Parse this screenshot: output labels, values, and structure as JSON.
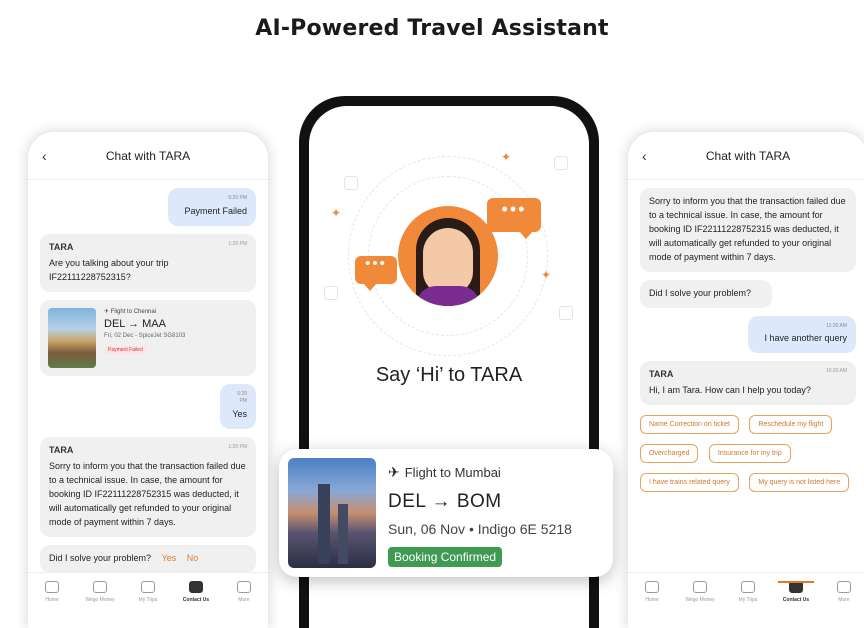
{
  "title": "AI-Powered Travel Assistant",
  "left_phone": {
    "header": {
      "back": "‹",
      "title": "Chat with TARA"
    },
    "messages": {
      "m1": {
        "time": "5:20 PM",
        "text": "Payment Failed"
      },
      "m2": {
        "name": "TARA",
        "time": "1:20 PM",
        "text": "Are you talking about your trip IF22111228752315?"
      },
      "trip": {
        "head": "Flight to Chennai",
        "route": "DEL → MAA",
        "date": "Fri, 02 Dec - SpiceJet SG8103",
        "status": "Payment Failed"
      },
      "m3": {
        "time": "5:20 PM",
        "text": "Yes"
      },
      "m4": {
        "name": "TARA",
        "time": "1:20 PM",
        "text": "Sorry to inform you that the transaction failed due to a technical issue. In case, the amount for booking ID IF22111228752315 was deducted, it will automatically get refunded to your original mode of payment within 7 days."
      },
      "m5": {
        "text": "Did I solve your problem?",
        "yes": "Yes",
        "no": "No"
      }
    }
  },
  "center_phone": {
    "say_hi": "Say ‘Hi’ to TARA",
    "bubble": "•••"
  },
  "flight_card": {
    "head": "Flight to Mumbai",
    "route": "DEL → BOM",
    "date": "Sun, 06 Nov • Indigo 6E 5218",
    "status": "Booking Confirmed"
  },
  "right_phone": {
    "header": {
      "back": "‹",
      "title": "Chat with TARA"
    },
    "messages": {
      "m1": {
        "text": "Sorry to inform you that the transaction failed due to a technical issue. In case, the amount for booking ID IF22111228752315 was deducted, it will automatically get refunded to your original mode of payment within 7 days."
      },
      "m2": {
        "text": "Did I solve your problem?"
      },
      "m3": {
        "time": "11:20 AM",
        "text": "I have another query"
      },
      "m4": {
        "name": "TARA",
        "time": "10:20 AM",
        "text": "Hi, I am Tara. How can I help you today?"
      }
    },
    "quick_replies": [
      "Name Correction on ticket",
      "Reschedule my flight",
      "Overcharged",
      "Insurance for my trip",
      "I have trains related query",
      "My query is not listed here"
    ]
  },
  "tabs": [
    "Home",
    "Wego Money",
    "My Trips",
    "Contact Us",
    "More"
  ],
  "colors": {
    "accent": "#f08a3a",
    "confirmed": "#3f9a52",
    "user_bubble": "#dde9fb"
  }
}
